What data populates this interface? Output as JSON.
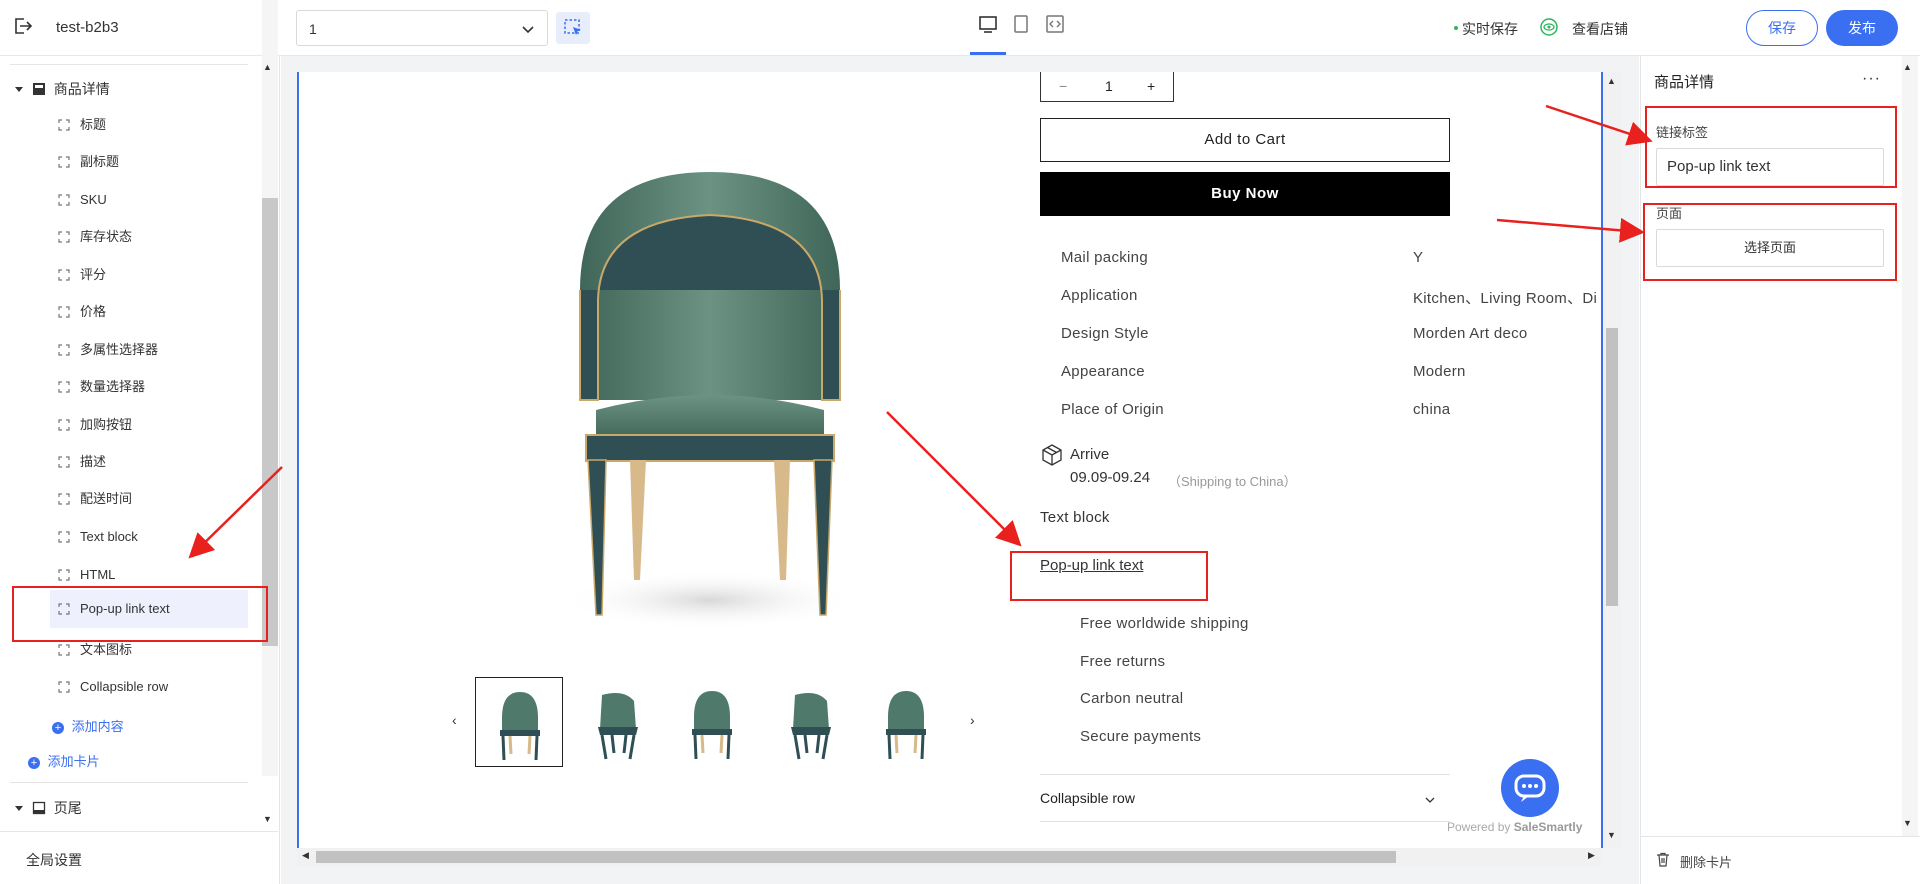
{
  "topbar": {
    "site_name": "test-b2b3",
    "page_select_value": "1",
    "autosave_label": "实时保存",
    "view_store_label": "查看店铺",
    "save_label": "保存",
    "publish_label": "发布"
  },
  "sidebar": {
    "section_title": "商品详情",
    "items": [
      {
        "label": "标题"
      },
      {
        "label": "副标题"
      },
      {
        "label": "SKU"
      },
      {
        "label": "库存状态"
      },
      {
        "label": "评分"
      },
      {
        "label": "价格"
      },
      {
        "label": "多属性选择器"
      },
      {
        "label": "数量选择器"
      },
      {
        "label": "加购按钮"
      },
      {
        "label": "描述"
      },
      {
        "label": "配送时间"
      },
      {
        "label": "Text block"
      },
      {
        "label": "HTML"
      },
      {
        "label": "Pop-up link text"
      },
      {
        "label": "文本图标"
      },
      {
        "label": "Collapsible row"
      }
    ],
    "add_content_label": "添加内容",
    "add_card_label": "添加卡片",
    "footer_section_title": "页尾",
    "global_settings_label": "全局设置"
  },
  "product": {
    "quantity": "1",
    "qty_minus": "−",
    "qty_plus": "+",
    "add_to_cart": "Add to Cart",
    "buy_now": "Buy Now",
    "attributes": [
      {
        "key": "Mail packing",
        "value": "Y"
      },
      {
        "key": "Application",
        "value": "Kitchen、Living Room、Di"
      },
      {
        "key": "Design Style",
        "value": "Morden Art deco"
      },
      {
        "key": "Appearance",
        "value": "Modern"
      },
      {
        "key": "Place of Origin",
        "value": "china"
      }
    ],
    "arrive_title": "Arrive",
    "arrive_dates": "09.09-09.24",
    "arrive_shipping": "（Shipping to China）",
    "text_block": "Text block",
    "popup_link": "Pop-up link text",
    "features": [
      "Free worldwide shipping",
      "Free returns",
      "Carbon neutral",
      "Secure payments"
    ],
    "collapsible_row": "Collapsible row",
    "powered_prefix": "Powered by",
    "powered_brand": "SaleSmartly",
    "carousel_prev": "‹",
    "carousel_next": "›"
  },
  "right_panel": {
    "title": "商品详情",
    "more": "···",
    "link_label_title": "链接标签",
    "link_label_value": "Pop-up link text",
    "page_title": "页面",
    "select_page_label": "选择页面",
    "delete_card_label": "删除卡片"
  },
  "colors": {
    "accent": "#3a6ff2",
    "annotation": "#e8211f",
    "chair_green": "#4f7a6b",
    "chair_frame": "#2f4f55"
  }
}
